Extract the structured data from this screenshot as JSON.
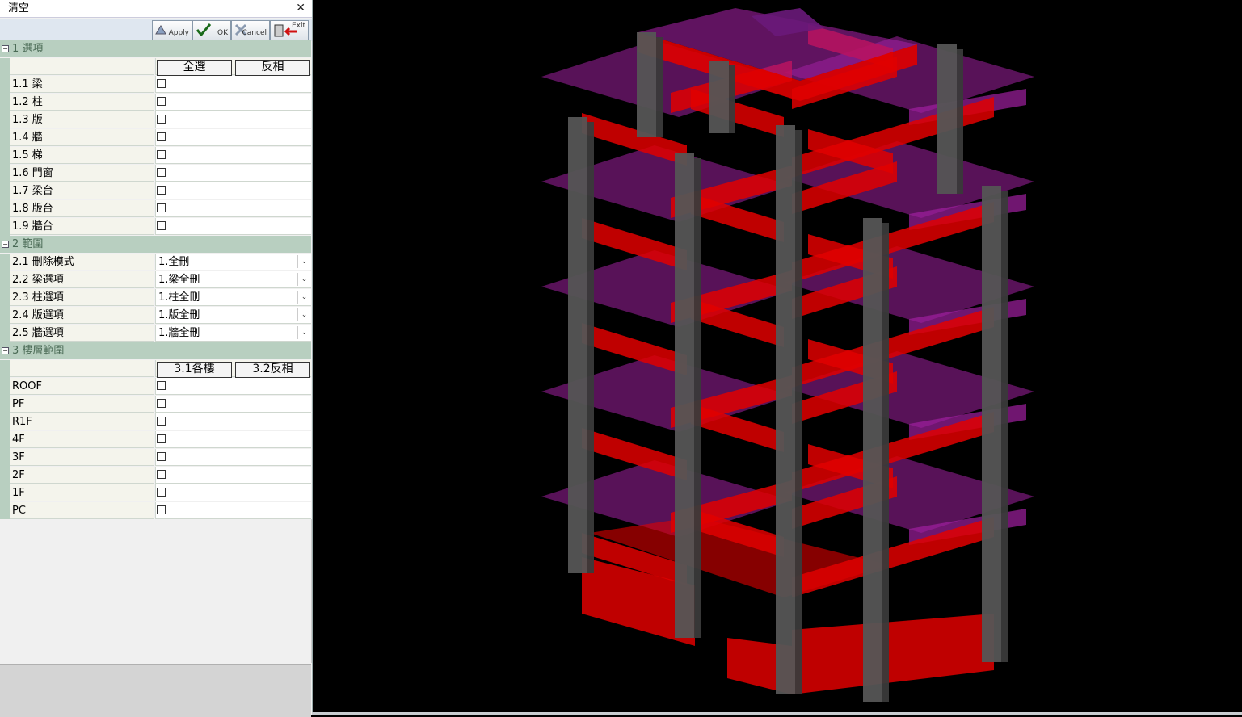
{
  "window": {
    "title": "清空",
    "close_glyph": "✕"
  },
  "toolbar": {
    "apply_label": "Apply",
    "ok_label": "OK",
    "cancel_label": "Cancel",
    "exit_label": "Exit"
  },
  "sections": {
    "options": {
      "title": "1 選項",
      "select_all": "全選",
      "invert": "反相",
      "items": [
        {
          "label": "1.1 梁",
          "checked": false
        },
        {
          "label": "1.2 柱",
          "checked": false
        },
        {
          "label": "1.3 版",
          "checked": false
        },
        {
          "label": "1.4 牆",
          "checked": false
        },
        {
          "label": "1.5 梯",
          "checked": false
        },
        {
          "label": "1.6 門窗",
          "checked": false
        },
        {
          "label": "1.7 梁台",
          "checked": false
        },
        {
          "label": "1.8 版台",
          "checked": false
        },
        {
          "label": "1.9 牆台",
          "checked": false
        }
      ]
    },
    "scope": {
      "title": "2 範圍",
      "items": [
        {
          "label": "2.1 刪除模式",
          "value": "1.全刪"
        },
        {
          "label": "2.2 梁選項",
          "value": "1.梁全刪"
        },
        {
          "label": "2.3 柱選項",
          "value": "1.柱全刪"
        },
        {
          "label": "2.4 版選項",
          "value": "1.版全刪"
        },
        {
          "label": "2.5 牆選項",
          "value": "1.牆全刪"
        }
      ]
    },
    "floors": {
      "title": "3 樓層範圍",
      "each_floor": "3.1各樓",
      "invert": "3.2反相",
      "items": [
        {
          "label": "ROOF",
          "checked": false
        },
        {
          "label": "PF",
          "checked": false
        },
        {
          "label": "R1F",
          "checked": false
        },
        {
          "label": "4F",
          "checked": false
        },
        {
          "label": "3F",
          "checked": false
        },
        {
          "label": "2F",
          "checked": false
        },
        {
          "label": "1F",
          "checked": false
        },
        {
          "label": "PC",
          "checked": false
        }
      ]
    }
  },
  "colors": {
    "beam": "#e00000",
    "slab": "#a020a0",
    "column": "#555555",
    "background": "#000000"
  }
}
